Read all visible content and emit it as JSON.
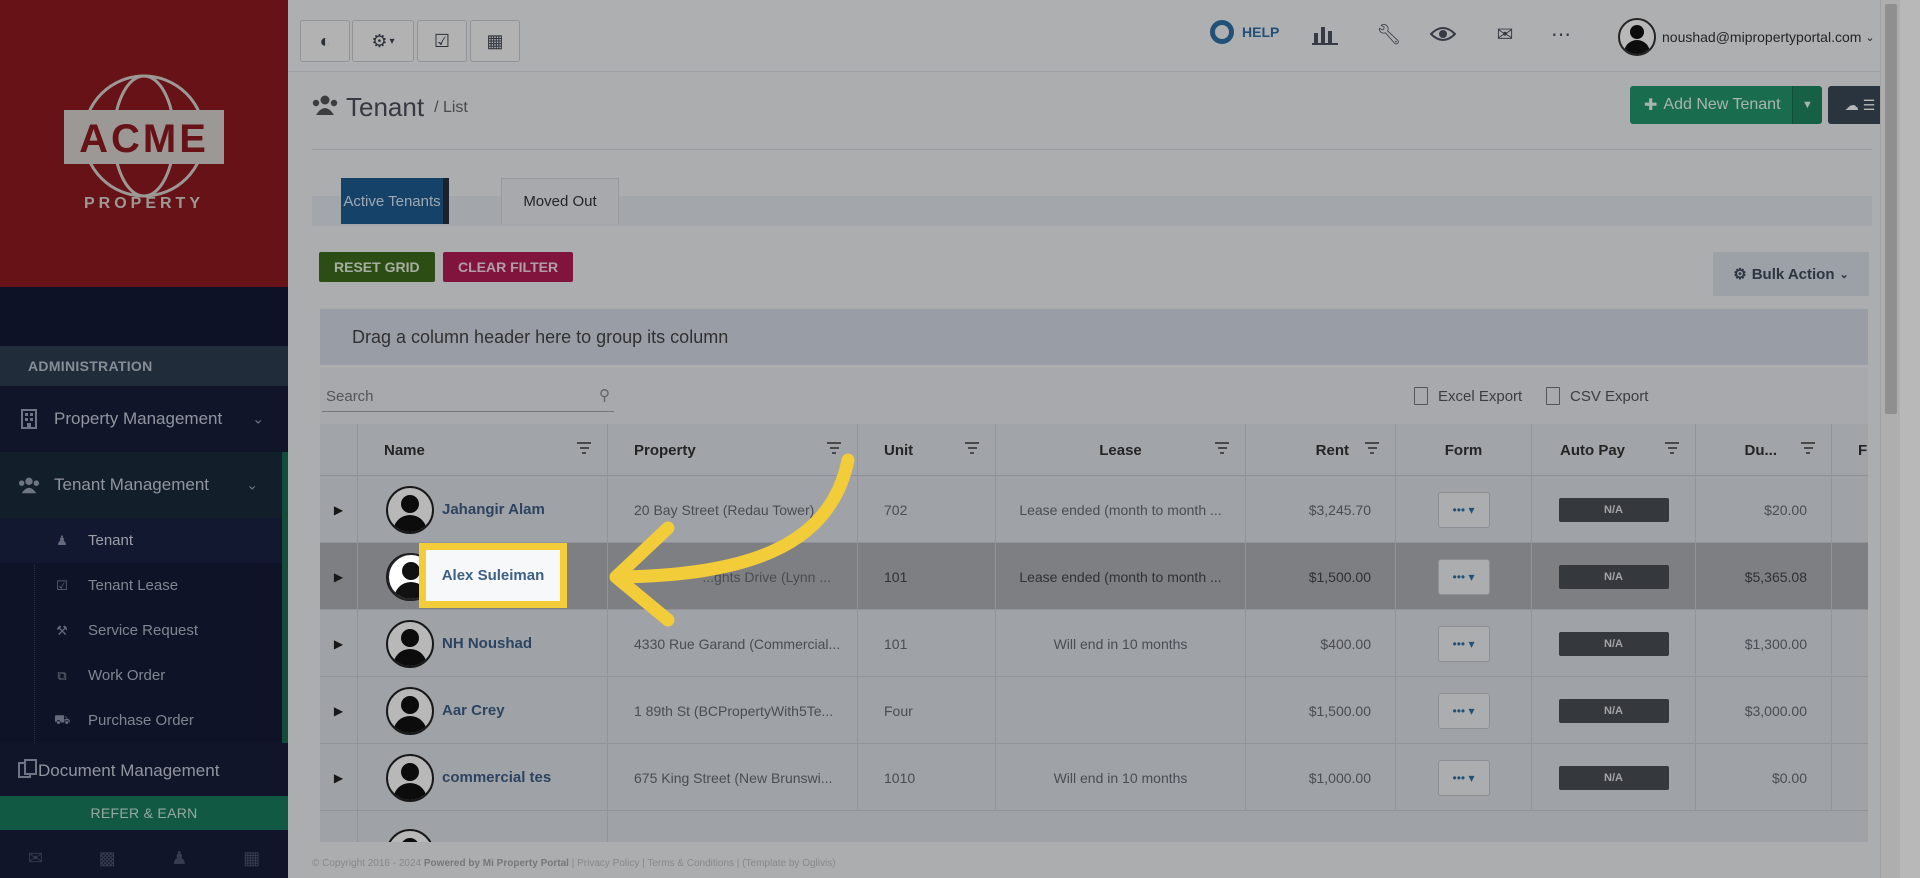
{
  "brand": {
    "logo_word": "ACME",
    "logo_sub": "PROPERTY"
  },
  "sidebar": {
    "admin_heading": "ADMINISTRATION",
    "sections": [
      {
        "label": "Property Management",
        "icon": "building-icon"
      },
      {
        "label": "Tenant Management",
        "icon": "users-icon"
      }
    ],
    "tenant_items": [
      {
        "label": "Tenant",
        "icon": "user-icon"
      },
      {
        "label": "Tenant Lease",
        "icon": "calendar-check-icon"
      },
      {
        "label": "Service Request",
        "icon": "wrench-icon"
      },
      {
        "label": "Work Order",
        "icon": "copy-icon"
      },
      {
        "label": "Purchase Order",
        "icon": "truck-icon"
      }
    ],
    "document_management": "Document Management",
    "refer_label": "REFER & EARN"
  },
  "topbar": {
    "help_label": "HELP",
    "user_email": "noushad@mipropertyportal.com"
  },
  "page": {
    "title": "Tenant",
    "subtitle": "/ List",
    "add_button": "Add New Tenant"
  },
  "tabs": {
    "active": "Active Tenants",
    "inactive": "Moved Out"
  },
  "actions": {
    "reset_grid": "RESET GRID",
    "clear_filter": "CLEAR FILTER",
    "bulk_action": "Bulk Action"
  },
  "grid": {
    "group_hint": "Drag a column header here to group its column",
    "search_placeholder": "Search",
    "excel_export": "Excel Export",
    "csv_export": "CSV Export",
    "columns": [
      "Name",
      "Property",
      "Unit",
      "Lease",
      "Rent",
      "Form",
      "Auto Pay",
      "Du...",
      "F"
    ],
    "rows": [
      {
        "name": "Jahangir Alam",
        "property": "20 Bay Street (Redau Tower)",
        "unit": "702",
        "lease": "Lease ended (month to month ...",
        "rent": "$3,245.70",
        "autopay": "N/A",
        "due": "$20.00"
      },
      {
        "name": "Alex Suleiman",
        "property": "...ghts Drive (Lynn ...",
        "unit": "101",
        "lease": "Lease ended (month to month ...",
        "rent": "$1,500.00",
        "autopay": "N/A",
        "due": "$5,365.08"
      },
      {
        "name": "NH Noushad",
        "property": "4330 Rue Garand (Commercial...",
        "unit": "101",
        "lease": "Will end in 10 months",
        "rent": "$400.00",
        "autopay": "N/A",
        "due": "$1,300.00"
      },
      {
        "name": "Aar Crey",
        "property": "1 89th St (BCPropertyWith5Te...",
        "unit": "Four",
        "lease": "",
        "rent": "$1,500.00",
        "autopay": "N/A",
        "due": "$3,000.00"
      },
      {
        "name": "commercial tes",
        "property": "675 King Street (New Brunswi...",
        "unit": "1010",
        "lease": "Will end in 10 months",
        "rent": "$1,000.00",
        "autopay": "N/A",
        "due": "$0.00"
      }
    ]
  },
  "footer": {
    "copyright": "© Copyright 2016 - 2024",
    "powered": "Powered by Mi Property Portal",
    "privacy": "Privacy Policy",
    "terms": "Terms & Conditions",
    "template": "(Template by Oglivis)"
  },
  "annotation": {
    "highlighted_name": "Alex Suleiman",
    "arrow_color": "#f2cc39"
  }
}
